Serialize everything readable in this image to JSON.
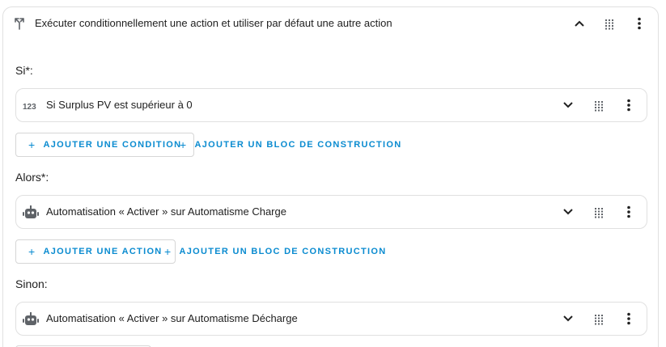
{
  "outer": {
    "title": "Exécuter conditionnellement une action et utiliser par défaut une autre action",
    "icon": "call-split-icon"
  },
  "if_section": {
    "label": "Si*:",
    "rows": [
      {
        "icon": "numeric-icon",
        "icon_text": "123",
        "title": "Si Surplus PV est supérieur à 0"
      }
    ],
    "add_button": "AJOUTER UNE CONDITION",
    "add_block_button": "AJOUTER UN BLOC DE CONSTRUCTION"
  },
  "then_section": {
    "label": "Alors*:",
    "rows": [
      {
        "icon": "robot-icon",
        "title": "Automatisation « Activer » sur Automatisme Charge"
      }
    ],
    "add_button": "AJOUTER UNE ACTION",
    "add_block_button": "AJOUTER UN BLOC DE CONSTRUCTION"
  },
  "else_section": {
    "label": "Sinon:",
    "rows": [
      {
        "icon": "robot-icon",
        "title": "Automatisation « Activer » sur Automatisme Décharge"
      }
    ]
  },
  "colors": {
    "accent": "#0a8bd0",
    "icon_grey": "#5f6368",
    "border": "#e0e0e0"
  }
}
